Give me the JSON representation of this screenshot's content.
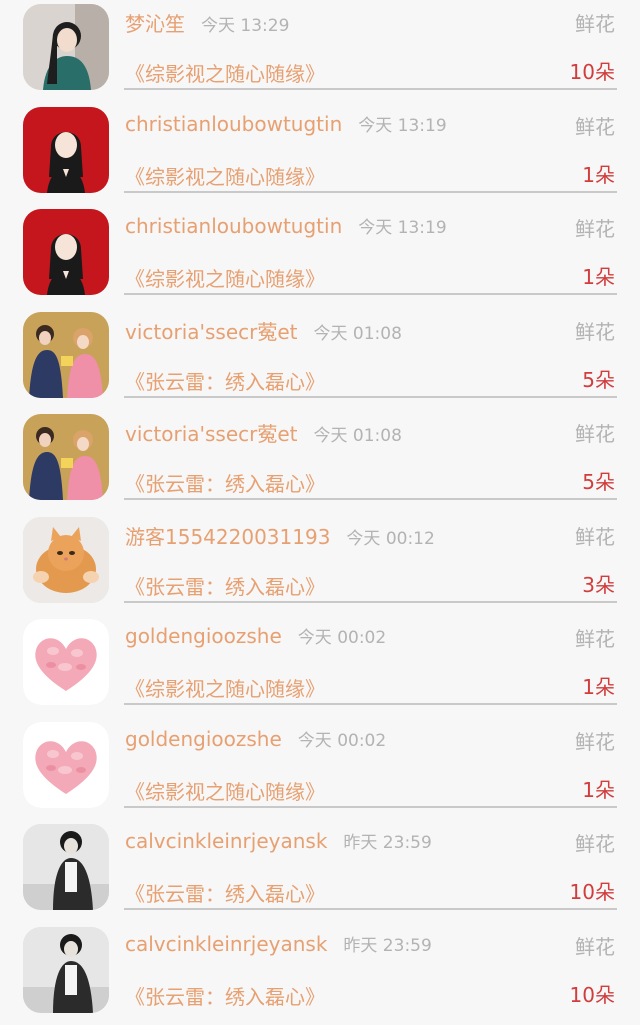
{
  "colors": {
    "name": "#e7a071",
    "muted": "#b3b3b3",
    "count": "#d23c3c",
    "background": "#f7f7f7"
  },
  "records": [
    {
      "user": "梦沁笙",
      "time": "今天 13:29",
      "gift": "鲜花",
      "book": "《综影视之随心随缘》",
      "count": "10朵",
      "avatar_icon": "girl-painting-avatar-icon"
    },
    {
      "user": "christianloubowtugtin",
      "time": "今天 13:19",
      "gift": "鲜花",
      "book": "《综影视之随心随缘》",
      "count": "1朵",
      "avatar_icon": "cartoon-girl-red-avatar-icon"
    },
    {
      "user": "christianloubowtugtin",
      "time": "今天 13:19",
      "gift": "鲜花",
      "book": "《综影视之随心随缘》",
      "count": "1朵",
      "avatar_icon": "cartoon-girl-red-avatar-icon"
    },
    {
      "user": "victoria'ssecr蒬et",
      "time": "今天 01:08",
      "gift": "鲜花",
      "book": "《张云雷：绣入磊心》",
      "count": "5朵",
      "avatar_icon": "couple-gift-avatar-icon"
    },
    {
      "user": "victoria'ssecr蒬et",
      "time": "今天 01:08",
      "gift": "鲜花",
      "book": "《张云雷：绣入磊心》",
      "count": "5朵",
      "avatar_icon": "couple-gift-avatar-icon"
    },
    {
      "user": "游客1554220031193",
      "time": "今天 00:12",
      "gift": "鲜花",
      "book": "《张云雷：绣入磊心》",
      "count": "3朵",
      "avatar_icon": "kitten-avatar-icon"
    },
    {
      "user": "goldengioozshe",
      "time": "今天 00:02",
      "gift": "鲜花",
      "book": "《综影视之随心随缘》",
      "count": "1朵",
      "avatar_icon": "petal-heart-avatar-icon"
    },
    {
      "user": "goldengioozshe",
      "time": "今天 00:02",
      "gift": "鲜花",
      "book": "《综影视之随心随缘》",
      "count": "1朵",
      "avatar_icon": "petal-heart-avatar-icon"
    },
    {
      "user": "calvcinkleinrjeyansk",
      "time": "昨天 23:59",
      "gift": "鲜花",
      "book": "《张云雷：绣入磊心》",
      "count": "10朵",
      "avatar_icon": "boy-bw-avatar-icon"
    },
    {
      "user": "calvcinkleinrjeyansk",
      "time": "昨天 23:59",
      "gift": "鲜花",
      "book": "《张云雷：绣入磊心》",
      "count": "10朵",
      "avatar_icon": "boy-bw-avatar-icon"
    }
  ]
}
